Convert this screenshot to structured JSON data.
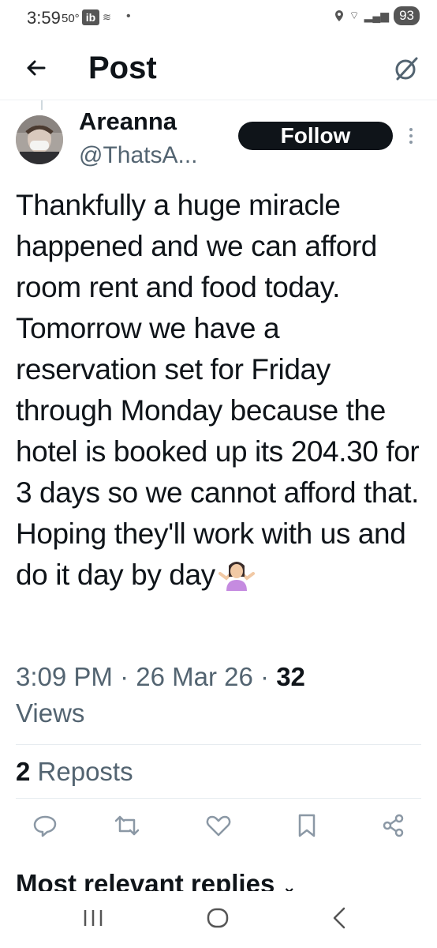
{
  "status_bar": {
    "time": "3:59",
    "temperature": "50°",
    "battery": "93",
    "icons": [
      "ib-app-icon",
      "wifi-off-icon",
      "dot-icon",
      "location-icon",
      "wifi-icon",
      "signal-icon"
    ]
  },
  "header": {
    "title": "Post",
    "back_icon": "arrow-left-icon",
    "grok_icon": "grok-icon"
  },
  "post": {
    "author_name": "Areanna",
    "author_handle": "@ThatsA...",
    "follow_label": "Follow",
    "text": "Thankfully a huge miracle happened and we can afford room rent and food today. Tomorrow we have a reservation set for Friday through Monday because the hotel is booked up its 204.30 for 3 days so we cannot afford that. Hoping they'll work with us and do it day by day",
    "emoji": "person-shrugging-emoji",
    "time": "3:09 PM",
    "date": "26 Mar 26",
    "views_count": "32",
    "views_label": "Views",
    "reposts_count": "2",
    "reposts_label": "Reposts"
  },
  "actions": [
    "reply-icon",
    "repost-icon",
    "like-icon",
    "bookmark-icon",
    "share-icon"
  ],
  "replies": {
    "heading": "Most relevant replies",
    "chevron": "chevron-down-icon"
  },
  "colors": {
    "text": "#0f1419",
    "secondary": "#536471",
    "icon": "#536471",
    "divider": "#e6ecf0"
  }
}
